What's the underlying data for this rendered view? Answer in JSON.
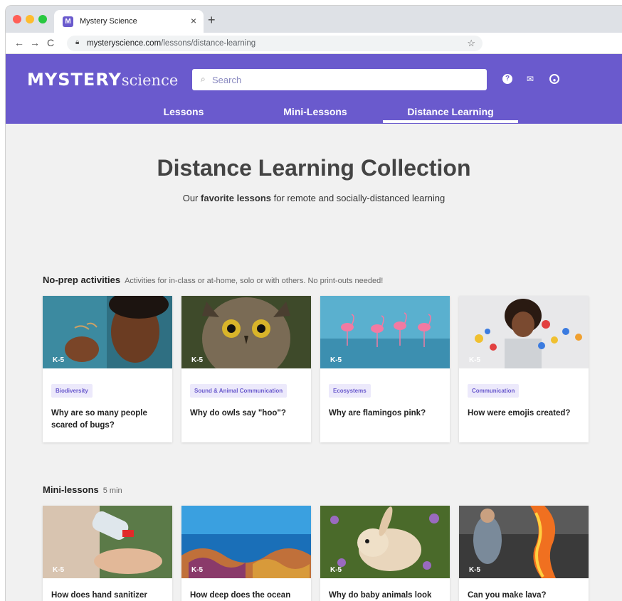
{
  "browser": {
    "tab_title": "Mystery Science",
    "favicon_letter": "M",
    "url_domain": "mysteryscience.com",
    "url_path": "/lessons/distance-learning"
  },
  "header": {
    "logo_bold": "MYSTERY",
    "logo_light": "science",
    "search_placeholder": "Search",
    "nav": [
      {
        "label": "Lessons"
      },
      {
        "label": "Mini-Lessons"
      },
      {
        "label": "Distance Learning"
      }
    ]
  },
  "hero": {
    "title": "Distance Learning Collection",
    "sub_before": "Our ",
    "sub_bold": "favorite lessons",
    "sub_after": " for remote and socially-distanced learning"
  },
  "sections": [
    {
      "name": "No-prep activities",
      "desc": "Activities for in-class or at-home, solo or with others. No print-outs needed!",
      "cards": [
        {
          "grade": "K-5",
          "tag": "Biodiversity",
          "question": "Why are so many people scared of bugs?",
          "image": "person-with-bug"
        },
        {
          "grade": "K-5",
          "tag": "Sound & Animal Communication",
          "question": "Why do owls say \"hoo\"?",
          "image": "owl"
        },
        {
          "grade": "K-5",
          "tag": "Ecosystems",
          "question": "Why are flamingos pink?",
          "image": "flamingos"
        },
        {
          "grade": "K-5",
          "tag": "Communication",
          "question": "How were emojis created?",
          "image": "girl-with-emojis"
        }
      ]
    },
    {
      "name": "Mini-lessons",
      "desc": "5 min",
      "cards": [
        {
          "grade": "K-5",
          "question": "How does hand sanitizer",
          "image": "hand-sanitizer"
        },
        {
          "grade": "K-5",
          "question": "How deep does the ocean",
          "image": "ocean-reef"
        },
        {
          "grade": "K-5",
          "question": "Why do baby animals look",
          "image": "bunny"
        },
        {
          "grade": "K-5",
          "question": "Can you make lava?",
          "image": "lava"
        }
      ]
    }
  ],
  "colors": {
    "brand": "#6a5acd",
    "page_bg": "#f1f1f1",
    "tag_bg": "#ece9fb"
  }
}
